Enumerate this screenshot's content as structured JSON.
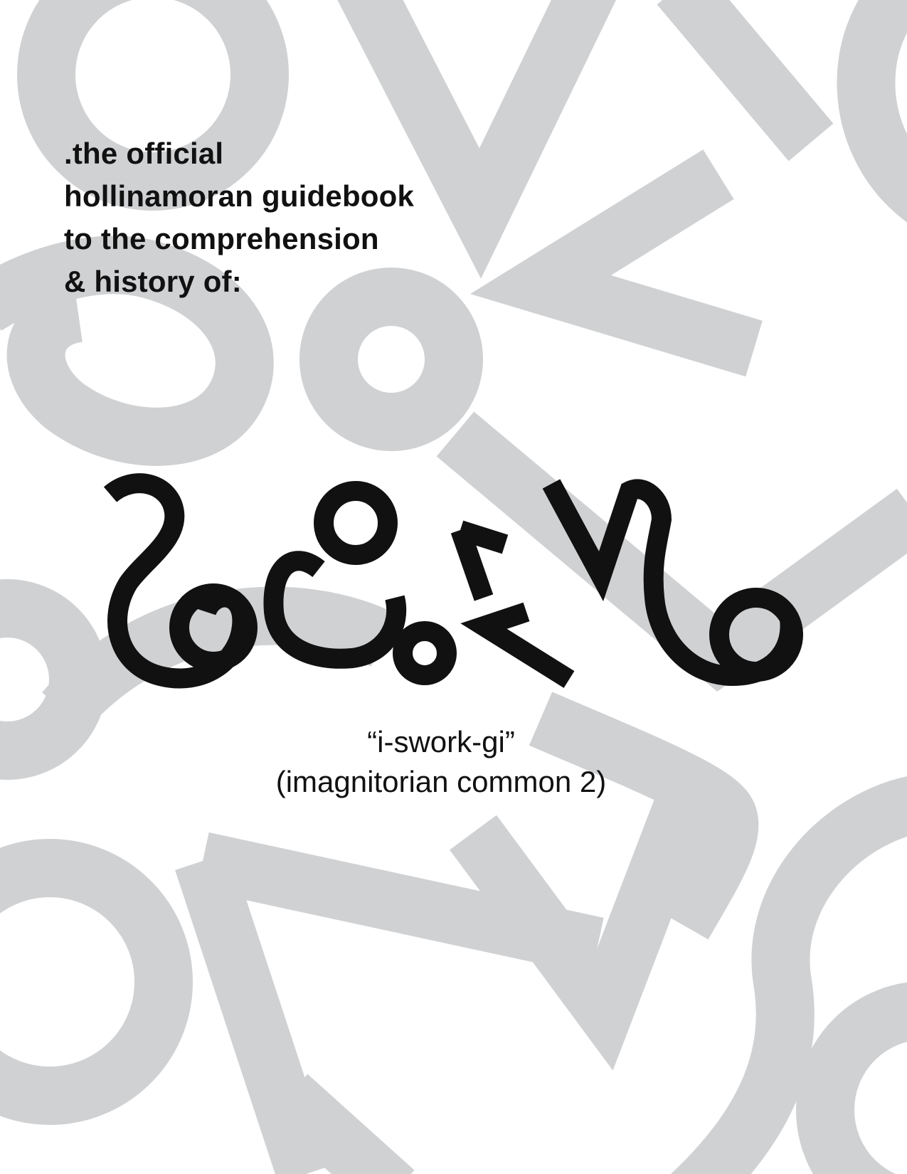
{
  "intro": {
    "line1": ".the official",
    "line2": "hollinamoran guidebook",
    "line3": "to the comprehension",
    "line4": "& history of:"
  },
  "subtitle": {
    "pronunciation": "“i-swork-gi”",
    "language_name": "(imagnitorian common 2)"
  },
  "colors": {
    "background": "#ffffff",
    "pattern": "#d0d1d3",
    "ink": "#111111"
  }
}
